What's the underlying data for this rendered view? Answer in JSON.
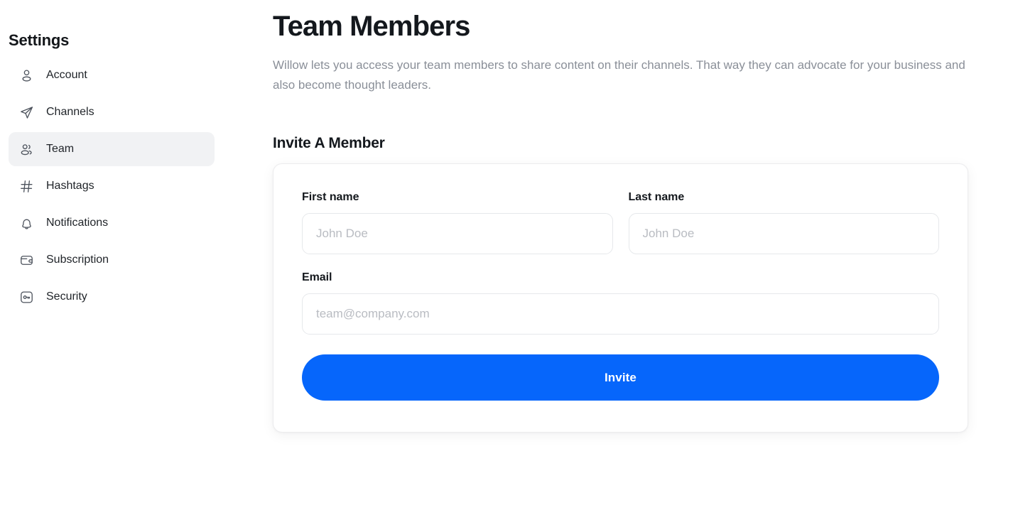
{
  "sidebar": {
    "title": "Settings",
    "items": [
      {
        "label": "Account",
        "icon": "user-icon",
        "active": false
      },
      {
        "label": "Channels",
        "icon": "paper-plane-icon",
        "active": false
      },
      {
        "label": "Team",
        "icon": "users-icon",
        "active": true
      },
      {
        "label": "Hashtags",
        "icon": "hash-icon",
        "active": false
      },
      {
        "label": "Notifications",
        "icon": "bell-icon",
        "active": false
      },
      {
        "label": "Subscription",
        "icon": "wallet-icon",
        "active": false
      },
      {
        "label": "Security",
        "icon": "key-square-icon",
        "active": false
      }
    ],
    "active_background": "#f1f2f4"
  },
  "main": {
    "title": "Team Members",
    "description": "Willow lets you access your team members to share content on their channels. That way they can advocate for your business and also become thought leaders.",
    "section_title": "Invite A Member",
    "form": {
      "first_name": {
        "label": "First name",
        "placeholder": "John Doe",
        "value": ""
      },
      "last_name": {
        "label": "Last name",
        "placeholder": "John Doe",
        "value": ""
      },
      "email": {
        "label": "Email",
        "placeholder": "team@company.com",
        "value": ""
      },
      "submit_label": "Invite",
      "submit_color": "#0666fb"
    }
  }
}
